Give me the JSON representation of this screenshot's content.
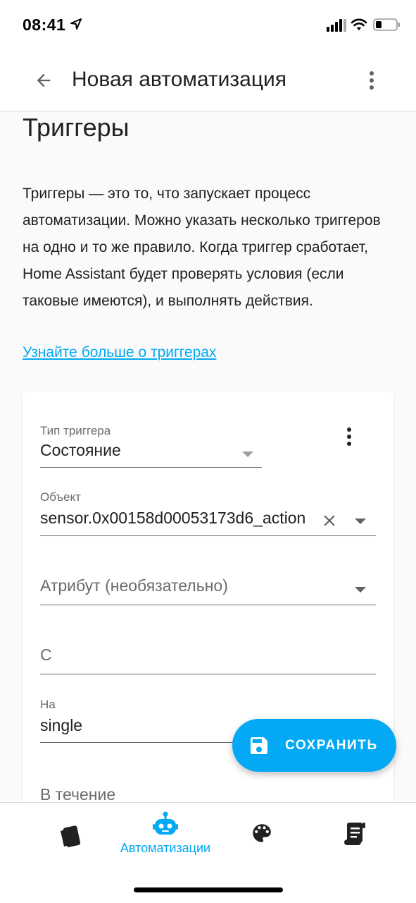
{
  "status_bar": {
    "time": "08:41"
  },
  "header": {
    "title": "Новая автоматизация"
  },
  "section": {
    "title": "Триггеры",
    "description": "Триггеры — это то, что запускает процесс автоматизации. Можно указать несколько триггеров на одно и то же правило. Когда триггер сработает, Home Assistant будет проверять условия (если таковые имеются), и выполнять действия.",
    "learn_more": "Узнайте больше о триггерах"
  },
  "trigger": {
    "type_label": "Тип триггера",
    "type_value": "Состояние",
    "entity_label": "Объект",
    "entity_value": "sensor.0x00158d00053173d6_action",
    "attribute_placeholder": "Атрибут (необязательно)",
    "from_placeholder": "С",
    "to_label": "На",
    "to_value": "single",
    "for_placeholder": "В течение"
  },
  "fab": {
    "label": "СОХРАНИТЬ"
  },
  "bottom_nav": {
    "automations_label": "Автоматизации"
  },
  "colors": {
    "accent": "#03a9f4",
    "background": "#fafafa"
  }
}
